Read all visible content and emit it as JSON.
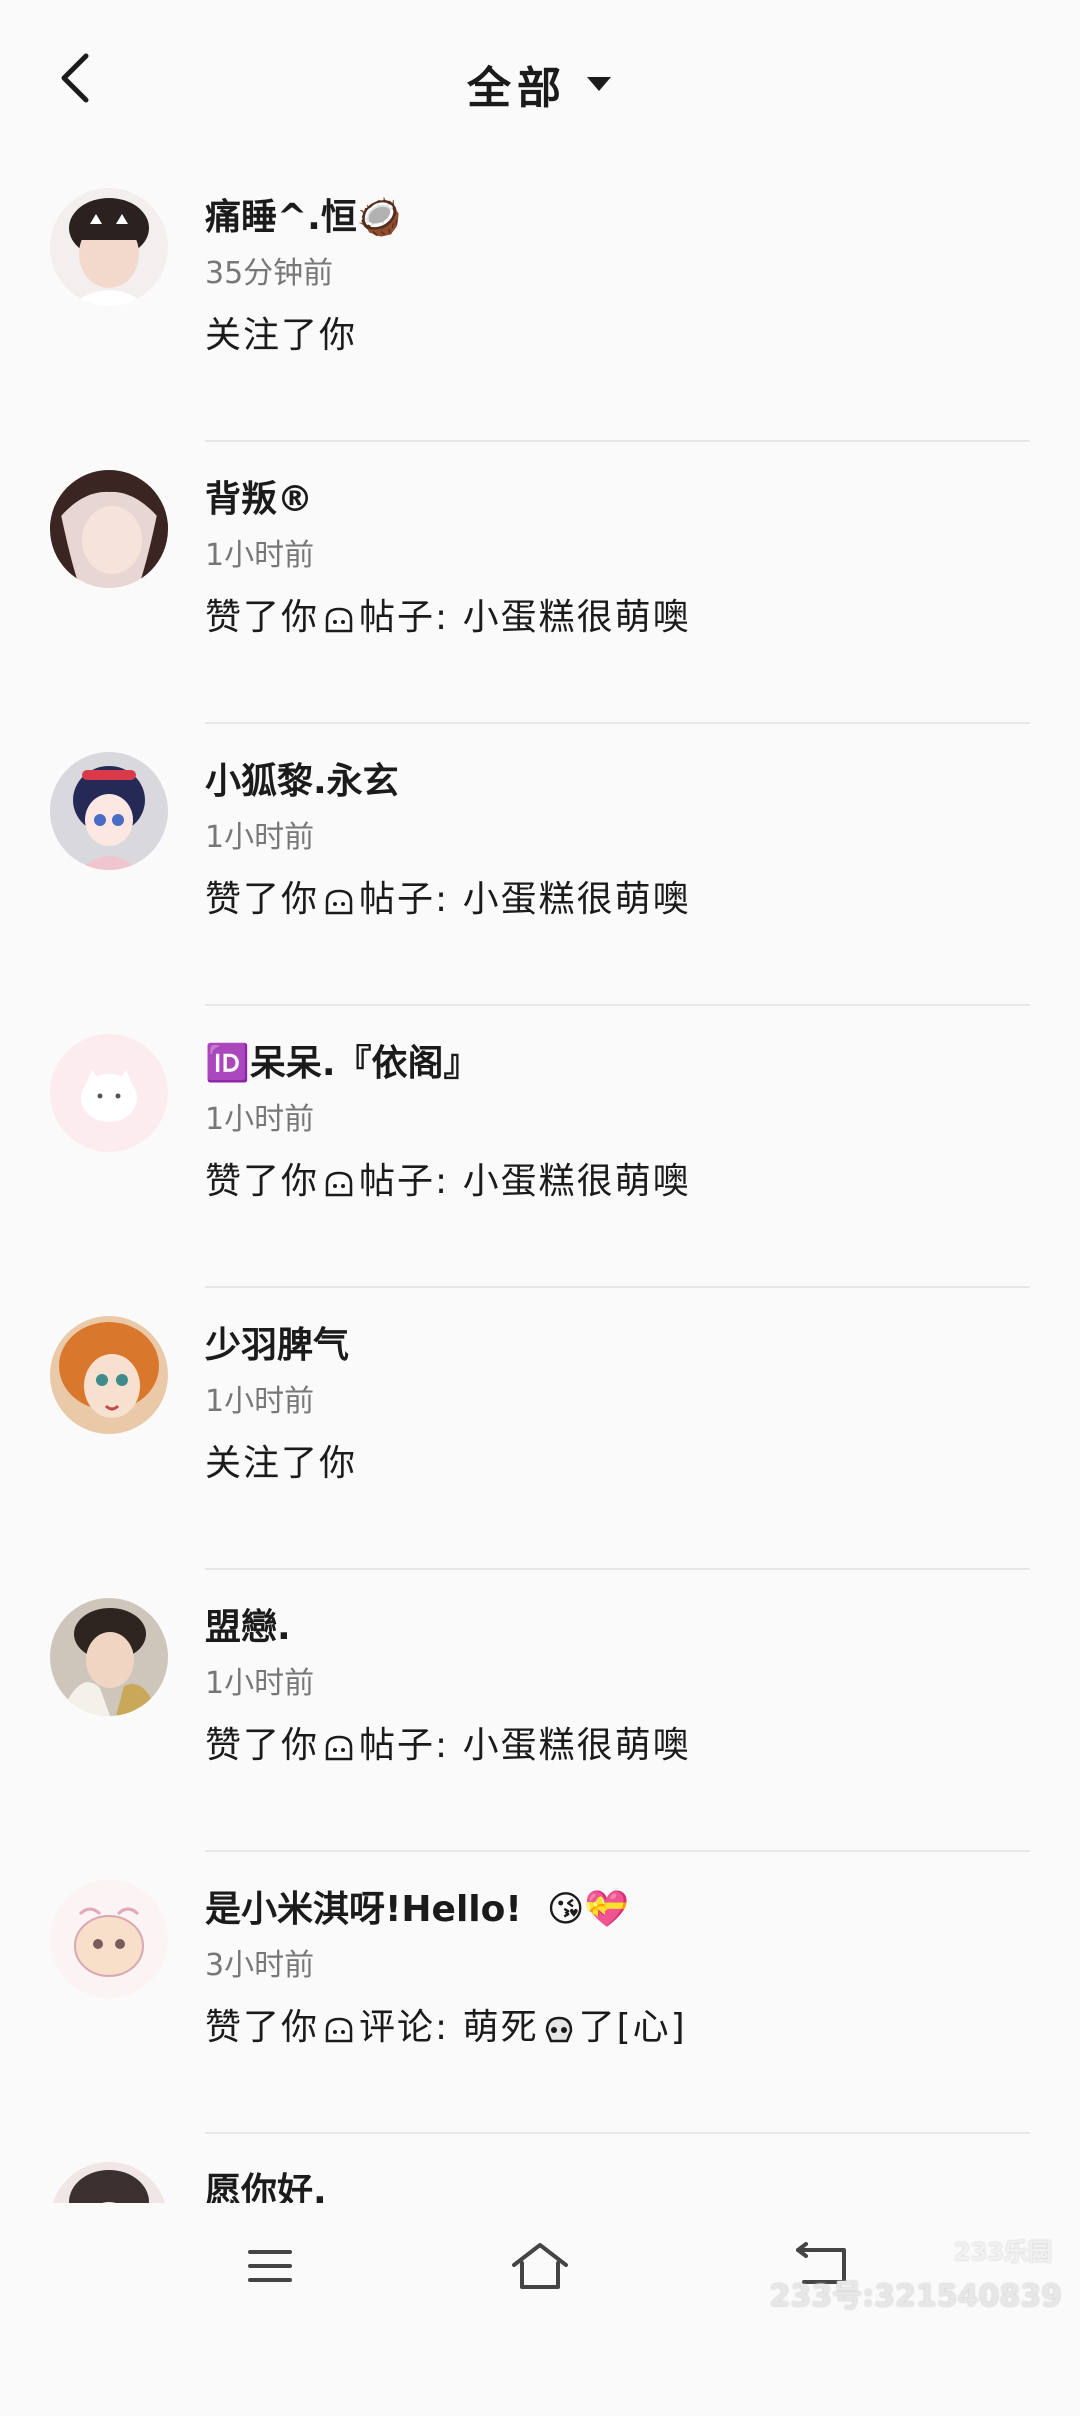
{
  "header": {
    "title": "全部"
  },
  "notifications": [
    {
      "name": "痛睡^.恒",
      "name_suffix": "🥥",
      "time": "35分钟前",
      "action": "关注了你",
      "post": ""
    },
    {
      "name": "背叛®",
      "name_suffix": "",
      "time": "1小时前",
      "action": "赞了你",
      "post_label": "帖子:",
      "post": "小蛋糕很萌噢"
    },
    {
      "name": "小狐黎.永玄",
      "name_suffix": "",
      "time": "1小时前",
      "action": "赞了你",
      "post_label": "帖子:",
      "post": "小蛋糕很萌噢"
    },
    {
      "name": "呆呆.『依阁』",
      "name_prefix": "🆔",
      "time": "1小时前",
      "action": "赞了你",
      "post_label": "帖子:",
      "post": "小蛋糕很萌噢"
    },
    {
      "name": "少羽脾气",
      "name_suffix": "",
      "time": "1小时前",
      "action": "关注了你",
      "post": ""
    },
    {
      "name": "盟戀.",
      "name_suffix": "",
      "time": "1小时前",
      "action": "赞了你",
      "post_label": "帖子:",
      "post": "小蛋糕很萌噢"
    },
    {
      "name": "是小米淇呀!Hello!",
      "name_suffix": "😘💝",
      "time": "3小时前",
      "action": "赞了你",
      "post_label": "评论:",
      "post": "萌死",
      "post_tail": "了[心]"
    },
    {
      "name": "愿你好.",
      "name_suffix": "",
      "time": "",
      "action": "",
      "post": ""
    }
  ],
  "watermark": {
    "logo": "233乐园",
    "text": "233号:321540839"
  },
  "colors": {
    "background": "#fbfafb",
    "text": "#1b1b1b",
    "muted": "#777777",
    "divider": "#e9e6ea"
  }
}
